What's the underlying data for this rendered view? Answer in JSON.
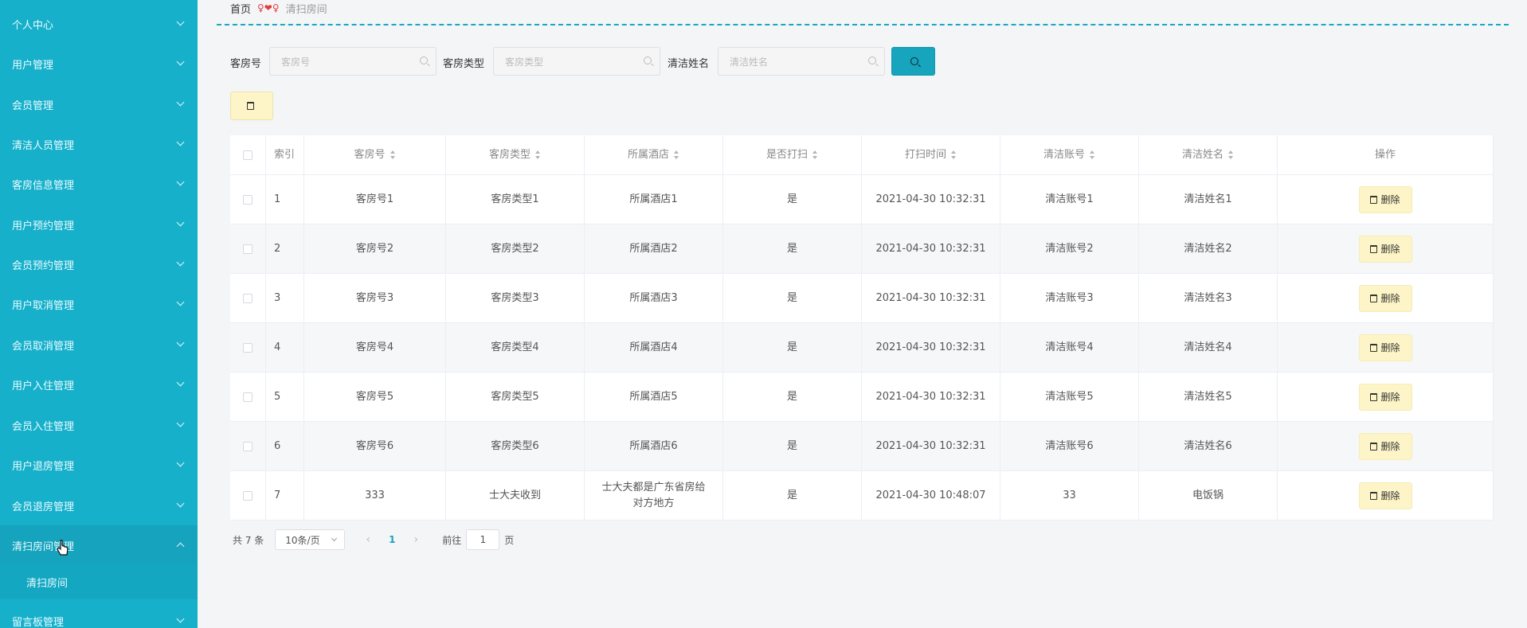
{
  "sidebar": {
    "items": [
      {
        "label": "个人中心"
      },
      {
        "label": "用户管理"
      },
      {
        "label": "会员管理"
      },
      {
        "label": "清洁人员管理"
      },
      {
        "label": "客房信息管理"
      },
      {
        "label": "用户预约管理"
      },
      {
        "label": "会员预约管理"
      },
      {
        "label": "用户取消管理"
      },
      {
        "label": "会员取消管理"
      },
      {
        "label": "用户入住管理"
      },
      {
        "label": "会员入住管理"
      },
      {
        "label": "用户退房管理"
      },
      {
        "label": "会员退房管理"
      },
      {
        "label": "清扫房间管理"
      },
      {
        "label": "留言板管理"
      }
    ],
    "sub_item": "清扫房间"
  },
  "breadcrumb": {
    "home": "首页",
    "separator": "♀❤♀",
    "current": "清扫房间"
  },
  "search": {
    "room_no_label": "客房号",
    "room_no_placeholder": "客房号",
    "room_type_label": "客房类型",
    "room_type_placeholder": "客房类型",
    "cleaner_name_label": "清洁姓名",
    "cleaner_name_placeholder": "清洁姓名"
  },
  "table": {
    "headers": {
      "index": "索引",
      "room_no": "客房号",
      "room_type": "客房类型",
      "hotel": "所属酒店",
      "cleaned": "是否打扫",
      "clean_time": "打扫时间",
      "cleaner_account": "清洁账号",
      "cleaner_name": "清洁姓名",
      "actions": "操作"
    },
    "delete_label": "删除",
    "rows": [
      {
        "index": "1",
        "room_no": "客房号1",
        "room_type": "客房类型1",
        "hotel": "所属酒店1",
        "cleaned": "是",
        "clean_time": "2021-04-30 10:32:31",
        "cleaner_account": "清洁账号1",
        "cleaner_name": "清洁姓名1"
      },
      {
        "index": "2",
        "room_no": "客房号2",
        "room_type": "客房类型2",
        "hotel": "所属酒店2",
        "cleaned": "是",
        "clean_time": "2021-04-30 10:32:31",
        "cleaner_account": "清洁账号2",
        "cleaner_name": "清洁姓名2"
      },
      {
        "index": "3",
        "room_no": "客房号3",
        "room_type": "客房类型3",
        "hotel": "所属酒店3",
        "cleaned": "是",
        "clean_time": "2021-04-30 10:32:31",
        "cleaner_account": "清洁账号3",
        "cleaner_name": "清洁姓名3"
      },
      {
        "index": "4",
        "room_no": "客房号4",
        "room_type": "客房类型4",
        "hotel": "所属酒店4",
        "cleaned": "是",
        "clean_time": "2021-04-30 10:32:31",
        "cleaner_account": "清洁账号4",
        "cleaner_name": "清洁姓名4"
      },
      {
        "index": "5",
        "room_no": "客房号5",
        "room_type": "客房类型5",
        "hotel": "所属酒店5",
        "cleaned": "是",
        "clean_time": "2021-04-30 10:32:31",
        "cleaner_account": "清洁账号5",
        "cleaner_name": "清洁姓名5"
      },
      {
        "index": "6",
        "room_no": "客房号6",
        "room_type": "客房类型6",
        "hotel": "所属酒店6",
        "cleaned": "是",
        "clean_time": "2021-04-30 10:32:31",
        "cleaner_account": "清洁账号6",
        "cleaner_name": "清洁姓名6"
      },
      {
        "index": "7",
        "room_no": "333",
        "room_type": "士大夫收到",
        "hotel": "士大夫都是广东省房给对方地方",
        "cleaned": "是",
        "clean_time": "2021-04-30 10:48:07",
        "cleaner_account": "33",
        "cleaner_name": "电饭锅"
      }
    ]
  },
  "pagination": {
    "total": "共 7 条",
    "page_size": "10条/页",
    "current_page": "1",
    "goto_label": "前往",
    "goto_value": "1",
    "page_suffix": "页"
  },
  "colors": {
    "sidebar": "#17b0cb",
    "accent": "#17a4bd",
    "delete_btn": "#fdf5c7"
  }
}
